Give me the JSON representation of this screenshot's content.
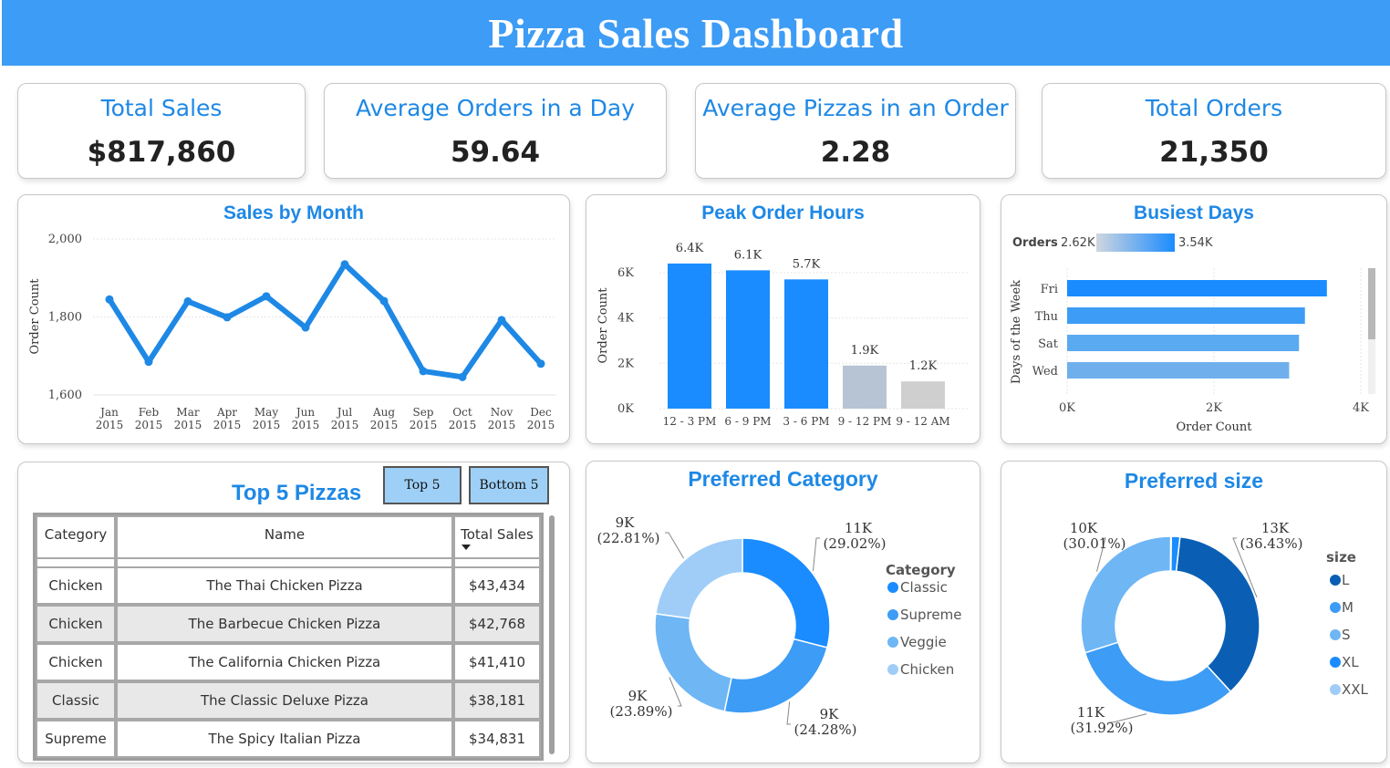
{
  "header": {
    "title": "Pizza Sales Dashboard"
  },
  "colors": {
    "header_bg": "#3d9cf5",
    "accent": "#1e88e5",
    "bar_top": "#1a8cff",
    "bar_low": "#b7c4d4",
    "bar_lowest": "#cfcfcf"
  },
  "kpis": [
    {
      "label": "Total Sales",
      "value": "$817,860"
    },
    {
      "label": "Average Orders in a Day",
      "value": "59.64"
    },
    {
      "label": "Average Pizzas in an Order",
      "value": "2.28"
    },
    {
      "label": "Total Orders",
      "value": "21,350"
    }
  ],
  "sales_by_month": {
    "title": "Sales by Month",
    "ylabel": "Order Count",
    "y_ticks": [
      "2,000",
      "1,800",
      "1,600"
    ],
    "ylim": [
      1600,
      2000
    ],
    "categories": [
      "Jan",
      "Feb",
      "Mar",
      "Apr",
      "May",
      "Jun",
      "Jul",
      "Aug",
      "Sep",
      "Oct",
      "Nov",
      "Dec"
    ],
    "year": "2015",
    "values": [
      1845,
      1685,
      1840,
      1799,
      1853,
      1773,
      1935,
      1841,
      1661,
      1646,
      1792,
      1680
    ]
  },
  "peak_hours": {
    "title": "Peak Order Hours",
    "ylabel": "Order Count",
    "y_ticks": [
      "6K",
      "4K",
      "2K",
      "0K"
    ],
    "ylim": [
      0,
      7000
    ],
    "categories": [
      "12 - 3 PM",
      "6 - 9 PM",
      "3 - 6 PM",
      "9 - 12 PM",
      "9 - 12 AM"
    ],
    "values": [
      6400,
      6100,
      5700,
      1900,
      1200
    ],
    "labels": [
      "6.4K",
      "6.1K",
      "5.7K",
      "1.9K",
      "1.2K"
    ]
  },
  "busiest_days": {
    "title": "Busiest Days",
    "legend_label": "Orders",
    "legend_min": "2.62K",
    "legend_max": "3.54K",
    "ylabel": "Days of the Week",
    "xlabel": "Order Count",
    "x_ticks": [
      "0K",
      "2K",
      "4K"
    ],
    "xlim": [
      0,
      4000
    ],
    "categories": [
      "Fri",
      "Thu",
      "Sat",
      "Wed"
    ],
    "values": [
      3538,
      3239,
      3158,
      3024
    ]
  },
  "top_pizzas": {
    "title": "Top 5 Pizzas",
    "btn_top": "Top 5",
    "btn_bottom": "Bottom 5",
    "columns": [
      "Category",
      "Name",
      "Total Sales"
    ],
    "rows": [
      [
        "Chicken",
        "The Thai Chicken Pizza",
        "$43,434"
      ],
      [
        "Chicken",
        "The Barbecue Chicken Pizza",
        "$42,768"
      ],
      [
        "Chicken",
        "The California Chicken Pizza",
        "$41,410"
      ],
      [
        "Classic",
        "The Classic Deluxe Pizza",
        "$38,181"
      ],
      [
        "Supreme",
        "The Spicy Italian Pizza",
        "$34,831"
      ]
    ]
  },
  "preferred_category": {
    "title": "Preferred Category",
    "legend_title": "Category",
    "items": [
      {
        "name": "Classic",
        "value": 29.02,
        "label": "11K",
        "pct": "(29.02%)",
        "color": "#1a8cff"
      },
      {
        "name": "Supreme",
        "value": 24.28,
        "label": "9K",
        "pct": "(24.28%)",
        "color": "#3d9cf5"
      },
      {
        "name": "Veggie",
        "value": 23.89,
        "label": "9K",
        "pct": "(23.89%)",
        "color": "#6fb6f5"
      },
      {
        "name": "Chicken",
        "value": 22.81,
        "label": "9K",
        "pct": "(22.81%)",
        "color": "#9fcdf8"
      }
    ]
  },
  "preferred_size": {
    "title": "Preferred size",
    "legend_title": "size",
    "items": [
      {
        "name": "L",
        "value": 36.43,
        "label": "13K",
        "pct": "(36.43%)",
        "color": "#0a5fb4"
      },
      {
        "name": "M",
        "value": 31.92,
        "label": "11K",
        "pct": "(31.92%)",
        "color": "#3d9cf5"
      },
      {
        "name": "S",
        "value": 30.01,
        "label": "10K",
        "pct": "(30.01%)",
        "color": "#6fb6f5"
      },
      {
        "name": "XL",
        "value": 1.54,
        "label": "",
        "pct": "",
        "color": "#1a8cff"
      },
      {
        "name": "XXL",
        "value": 0.1,
        "label": "",
        "pct": "",
        "color": "#9fcdf8"
      }
    ]
  }
}
